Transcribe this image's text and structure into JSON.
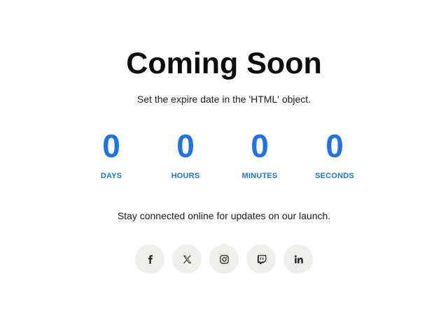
{
  "header": {
    "title": "Coming Soon",
    "subtitle": "Set the expire date in the 'HTML' object."
  },
  "countdown": {
    "accent_color": "#1e74e6",
    "units": [
      {
        "value": "0",
        "label": "DAYS"
      },
      {
        "value": "0",
        "label": "HOURS"
      },
      {
        "value": "0",
        "label": "MINUTES"
      },
      {
        "value": "0",
        "label": "SECONDS"
      }
    ]
  },
  "footer": {
    "message": "Stay connected online for updates on our launch.",
    "socials": [
      {
        "icon": "facebook-icon"
      },
      {
        "icon": "x-icon"
      },
      {
        "icon": "instagram-icon"
      },
      {
        "icon": "twitch-icon"
      },
      {
        "icon": "linkedin-icon"
      }
    ],
    "social_bg_color": "#efefee"
  }
}
